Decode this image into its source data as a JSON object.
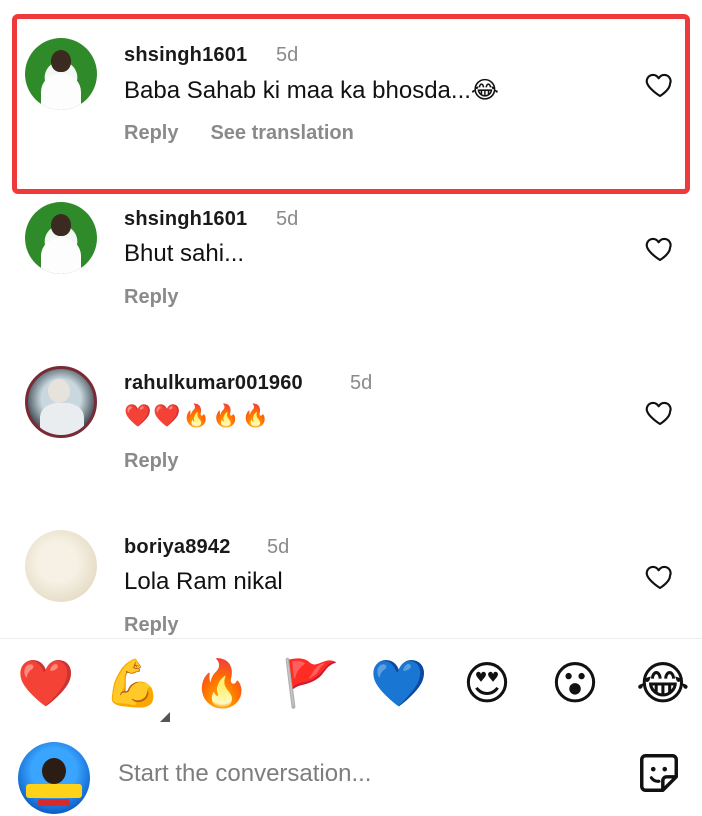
{
  "comments": [
    {
      "username": "shsingh1601",
      "time": "5d",
      "text": "Baba Sahab ki maa ka bhosda...",
      "emoji": "😂",
      "reply": "Reply",
      "translate": "See translation"
    },
    {
      "username": "shsingh1601",
      "time": "5d",
      "text": "Bhut sahi...",
      "emoji": "",
      "reply": "Reply"
    },
    {
      "username": "rahulkumar001960",
      "time": "5d",
      "text": "",
      "emoji": "❤️❤️🔥🔥🔥",
      "reply": "Reply"
    },
    {
      "username": "boriya8942",
      "time": "5d",
      "text": "Lola Ram nikal",
      "emoji": "",
      "reply": "Reply"
    }
  ],
  "reactions": [
    "❤️",
    "💪",
    "🔥",
    "🚩",
    "💙",
    "😍",
    "😮",
    "😂"
  ],
  "composer": {
    "placeholder": "Start the conversation..."
  },
  "icons": {
    "like": "heart-outline-icon",
    "sticker": "sticker-icon"
  },
  "colors": {
    "highlight": "#ee3a3a",
    "muted": "#8a8a8a"
  }
}
